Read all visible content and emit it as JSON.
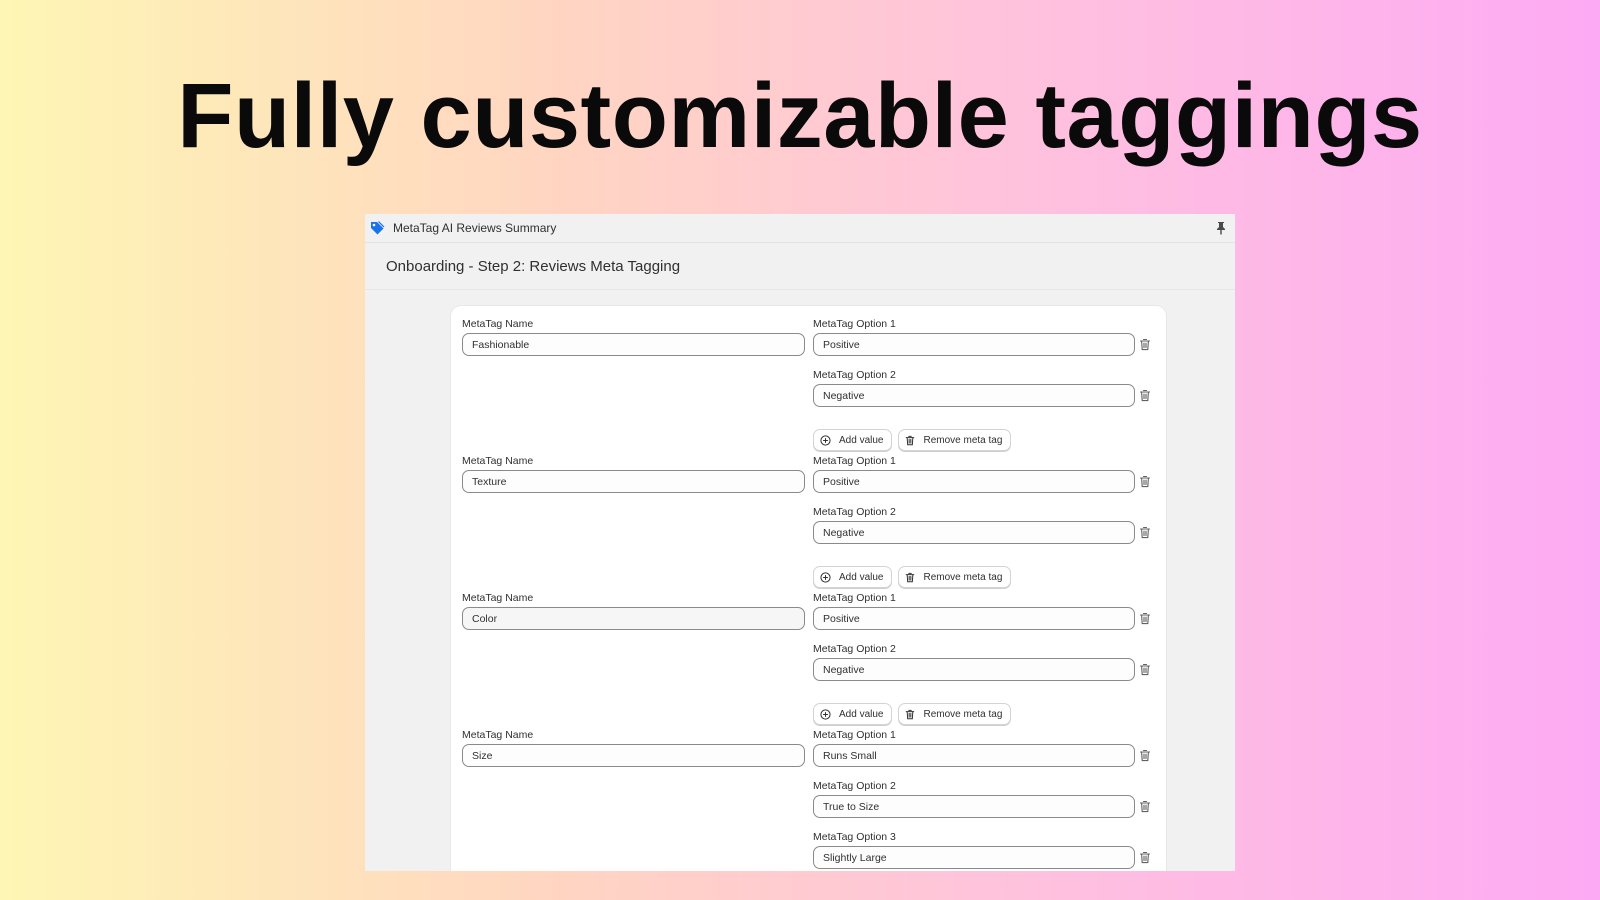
{
  "headline": "Fully customizable taggings",
  "app": {
    "title": "MetaTag AI Reviews Summary",
    "icon": "tag-icon",
    "pin_icon": "pin-icon",
    "accent": "#1a73e8"
  },
  "page": {
    "title": "Onboarding - Step 2: Reviews Meta Tagging"
  },
  "labels": {
    "name": "MetaTag Name",
    "option_prefix": "MetaTag Option",
    "add_value": "Add value",
    "remove_meta_tag": "Remove meta tag"
  },
  "metatags": [
    {
      "name_label": "MetaTag Name",
      "name": "Fashionable",
      "options": [
        {
          "label": "MetaTag Option 1",
          "value": "Positive"
        },
        {
          "label": "MetaTag Option 2",
          "value": "Negative"
        }
      ],
      "add_value": "Add value",
      "remove": "Remove meta tag"
    },
    {
      "name_label": "MetaTag Name",
      "name": "Texture",
      "options": [
        {
          "label": "MetaTag Option 1",
          "value": "Positive"
        },
        {
          "label": "MetaTag Option 2",
          "value": "Negative"
        }
      ],
      "add_value": "Add value",
      "remove": "Remove meta tag"
    },
    {
      "name_label": "MetaTag Name",
      "name": "Color",
      "options": [
        {
          "label": "MetaTag Option 1",
          "value": "Positive"
        },
        {
          "label": "MetaTag Option 2",
          "value": "Negative"
        }
      ],
      "add_value": "Add value",
      "remove": "Remove meta tag"
    },
    {
      "name_label": "MetaTag Name",
      "name": "Size",
      "options": [
        {
          "label": "MetaTag Option 1",
          "value": "Runs Small"
        },
        {
          "label": "MetaTag Option 2",
          "value": "True to Size"
        },
        {
          "label": "MetaTag Option 3",
          "value": "Slightly Large"
        }
      ]
    }
  ]
}
